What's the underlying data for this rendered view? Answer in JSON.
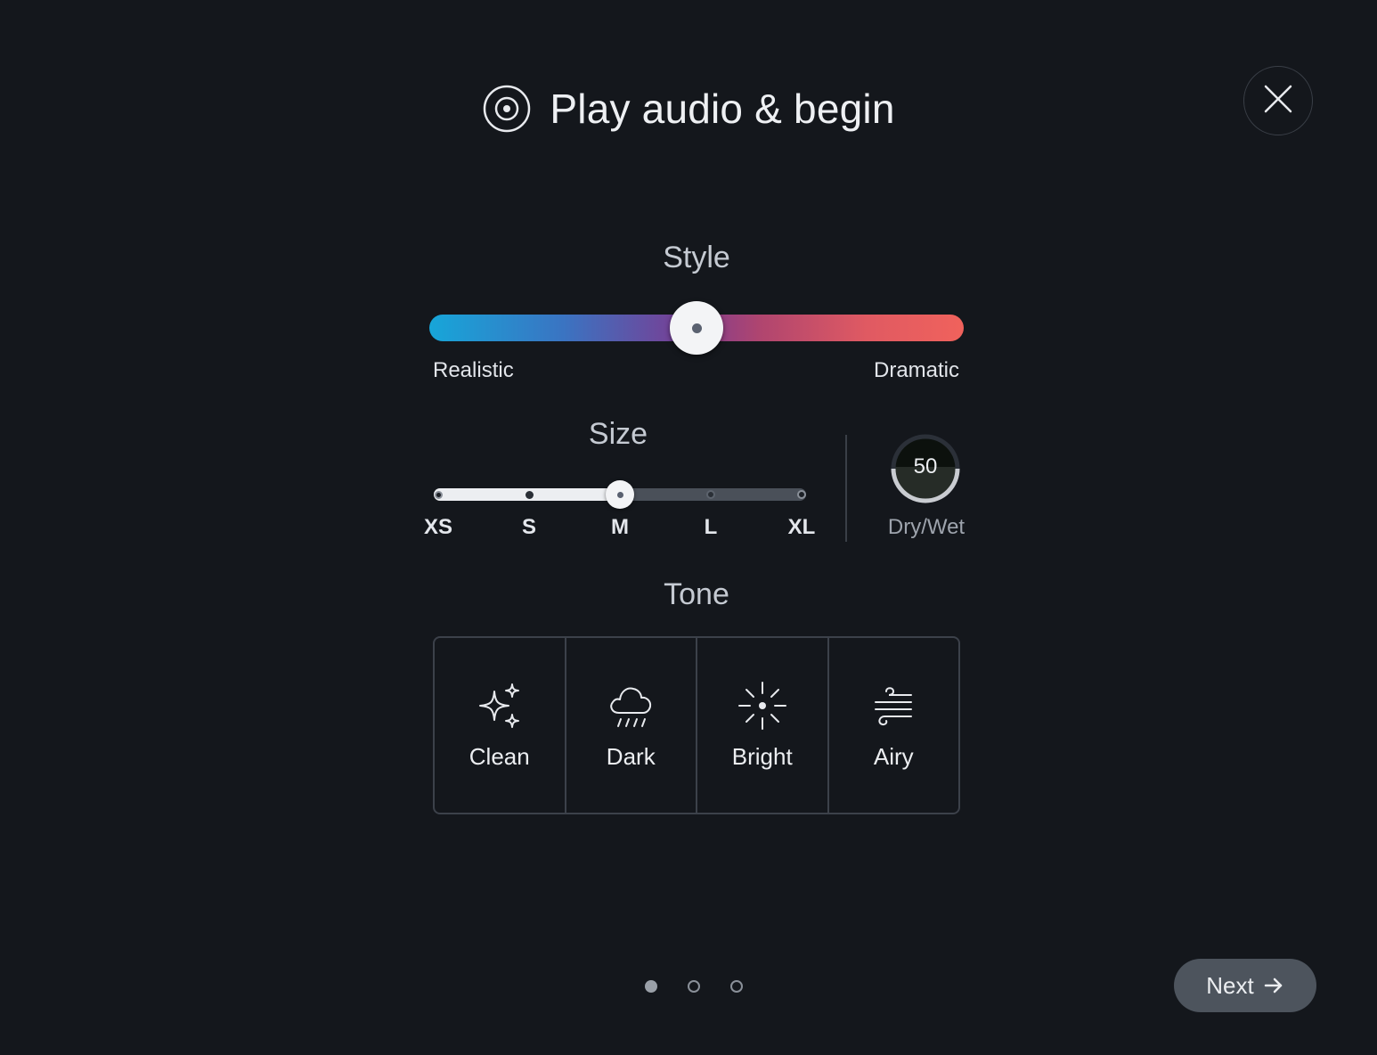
{
  "header": {
    "title": "Play audio & begin",
    "icon": "disc-icon",
    "close_icon": "close-icon"
  },
  "style_control": {
    "label": "Style",
    "min_label": "Realistic",
    "max_label": "Dramatic",
    "value_fraction": 0.5,
    "gradient_colors": [
      "#17a6d9",
      "#7a3d93",
      "#f0625c"
    ]
  },
  "size_control": {
    "label": "Size",
    "options": [
      "XS",
      "S",
      "M",
      "L",
      "XL"
    ],
    "selected": "M",
    "selected_index": 2
  },
  "drywet": {
    "value": "50",
    "label": "Dry/Wet"
  },
  "tone": {
    "label": "Tone",
    "options": [
      {
        "label": "Clean",
        "icon": "sparkles-icon",
        "selected": true
      },
      {
        "label": "Dark",
        "icon": "rain-cloud-icon",
        "selected": false
      },
      {
        "label": "Bright",
        "icon": "sun-burst-icon",
        "selected": false
      },
      {
        "label": "Airy",
        "icon": "wind-icon",
        "selected": false
      }
    ]
  },
  "pager": {
    "count": 3,
    "active_index": 0
  },
  "footer": {
    "next_label": "Next",
    "next_icon": "arrow-right-icon"
  },
  "colors": {
    "background": "#14171c",
    "selected_tile": "#565d66",
    "button": "#4d545d"
  }
}
